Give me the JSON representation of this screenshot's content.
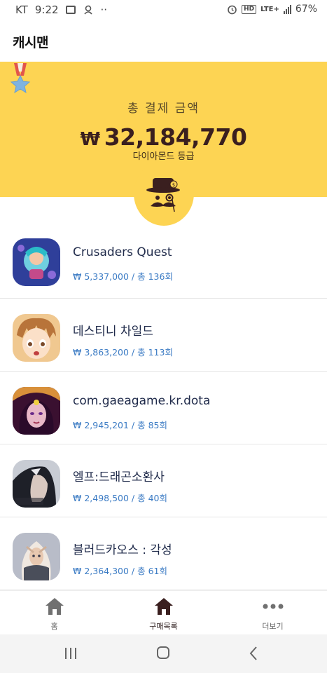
{
  "status_bar": {
    "carrier": "KT",
    "time": "9:22",
    "dots": "··",
    "network": "LTE+",
    "battery": "67%"
  },
  "app": {
    "title": "캐시맨"
  },
  "summary": {
    "label": "총 결제 금액",
    "currency": "₩",
    "amount": "32,184,770",
    "grade": "다이아몬드 등급"
  },
  "purchases": [
    {
      "name": "Crusaders Quest",
      "detail": "₩ 5,337,000 / 총 136회",
      "icon": "crusaders-quest-app-icon",
      "color": "#4a63b8"
    },
    {
      "name": "데스티니 차일드",
      "detail": "₩ 3,863,200 / 총 113회",
      "icon": "destiny-child-app-icon",
      "color": "#e0a86a"
    },
    {
      "name": "com.gaeagame.kr.dota",
      "detail": "₩ 2,945,201 / 총 85회",
      "icon": "dota-app-icon",
      "color": "#6b2a5a"
    },
    {
      "name": "엘프:드래곤소환사",
      "detail": "₩ 2,498,500 / 총 40회",
      "icon": "elf-dragon-summoner-app-icon",
      "color": "#3a3f4a"
    },
    {
      "name": "블러드카오스 : 각성",
      "detail": "₩ 2,364,300 / 총 61회",
      "icon": "blood-chaos-app-icon",
      "color": "#7a7f8a"
    }
  ],
  "bottom_nav": {
    "home": "홈",
    "purchases": "구매목록",
    "more": "더보기"
  },
  "colors": {
    "banner": "#fdd453",
    "accent_dark": "#3a1f1f",
    "link_blue": "#3b7bc4"
  }
}
